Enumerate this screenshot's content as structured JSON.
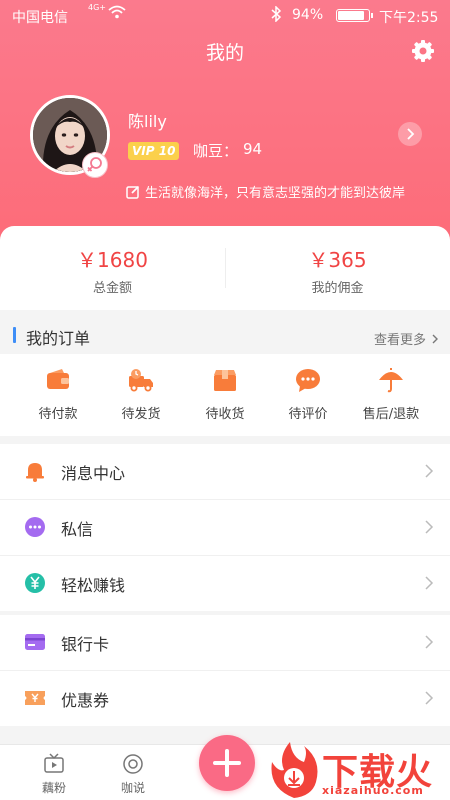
{
  "status": {
    "carrier": "中国电信",
    "network": "4G+",
    "battery": "94%",
    "battery_level": 0.94,
    "time": "下午2:55"
  },
  "header": {
    "title": "我的"
  },
  "profile": {
    "name": "陈lily",
    "vip": "VIP 10",
    "beans_label": "咖豆：",
    "beans_value": "94",
    "motto": "生活就像海洋，只有意志坚强的才能到达彼岸"
  },
  "money": [
    {
      "value": "￥1680",
      "label": "总金额"
    },
    {
      "value": "￥365",
      "label": "我的佣金"
    }
  ],
  "orders": {
    "title": "我的订单",
    "more": "查看更多",
    "items": [
      {
        "label": "待付款",
        "icon": "wallet-icon"
      },
      {
        "label": "待发货",
        "icon": "truck-icon"
      },
      {
        "label": "待收货",
        "icon": "box-icon"
      },
      {
        "label": "待评价",
        "icon": "chat-bubble-icon"
      },
      {
        "label": "售后/退款",
        "icon": "umbrella-icon"
      }
    ]
  },
  "menu": [
    {
      "label": "消息中心",
      "icon": "bell-icon"
    },
    {
      "label": "私信",
      "icon": "message-icon"
    },
    {
      "label": "轻松赚钱",
      "icon": "yuan-coin-icon"
    },
    {
      "label": "银行卡",
      "icon": "bank-card-icon"
    },
    {
      "label": "优惠券",
      "icon": "coupon-icon"
    }
  ],
  "tabs": [
    {
      "label": "藕粉"
    },
    {
      "label": "咖说"
    }
  ],
  "watermark": {
    "text": "下载火",
    "sub": "xiazaihuo.com"
  },
  "colors": {
    "header": "#fb7a8d",
    "accent_red": "#f04444",
    "vip_gold": "#fbd04b",
    "plus_button": "#fa6a85",
    "order_icon": "#f87c3a"
  }
}
